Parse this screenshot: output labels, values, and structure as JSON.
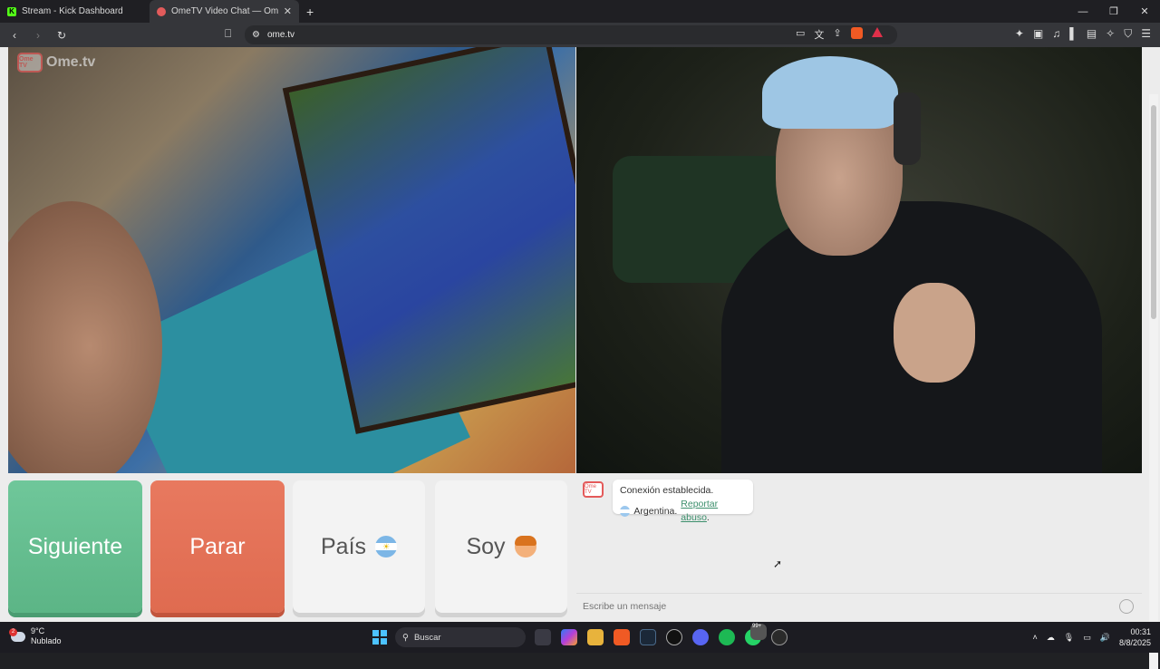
{
  "browser": {
    "tabs": [
      {
        "title": "Stream - Kick Dashboard",
        "active": false
      },
      {
        "title": "OmeTV Video Chat — Omeg",
        "active": true
      }
    ],
    "url": "ome.tv"
  },
  "page": {
    "logo_text": "Ome.tv",
    "logo_badge": "Ome TV",
    "buttons": {
      "next": "Siguiente",
      "stop": "Parar",
      "country": "País",
      "gender": "Soy"
    },
    "chat": {
      "system_message": "Conexión establecida.",
      "country": "Argentina.",
      "report_link": "Reportar abuso",
      "report_suffix": ".",
      "input_placeholder": "Escribe un mensaje"
    }
  },
  "taskbar": {
    "weather_temp": "9°C",
    "weather_desc": "Nublado",
    "weather_badge": "2",
    "search_label": "Buscar",
    "whatsapp_badge": "99+",
    "time": "00:31",
    "date": "8/8/2025"
  },
  "colors": {
    "next_button": "#6fc79a",
    "stop_button": "#e8795f",
    "report_link": "#3c8f6c",
    "ome_red": "#e45a5a"
  }
}
